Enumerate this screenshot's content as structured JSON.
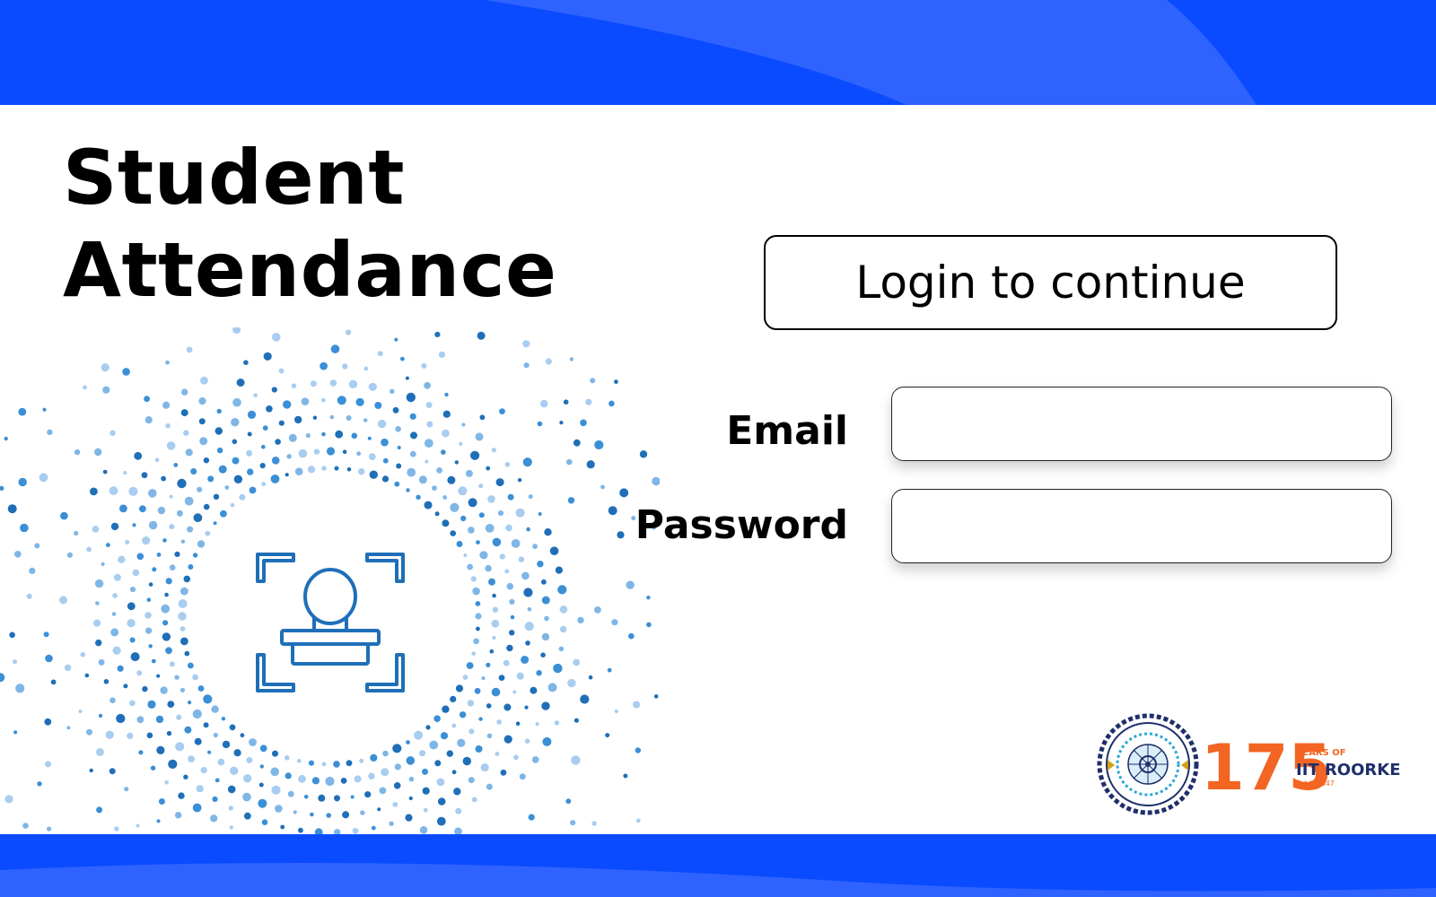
{
  "page": {
    "title_line1": "Student",
    "title_line2": "Attendance",
    "login_heading": "Login to continue"
  },
  "form": {
    "email_label": "Email",
    "email_value": "",
    "password_label": "Password",
    "password_value": ""
  },
  "branding": {
    "badge_years_of": "YEARS OF",
    "badge_name": "IIT ROORKEE",
    "badge_estd": "Estd. 1847",
    "badge_number": "175"
  },
  "colors": {
    "band_blue": "#0a4bff",
    "band_light": "#2f63ff",
    "dot_blue": "#1f6fb8",
    "accent_orange": "#f26522",
    "logo_navy": "#1f2f6b"
  },
  "icons": {
    "face_scan": "face-scan-icon",
    "seal": "iit-roorkee-seal"
  }
}
